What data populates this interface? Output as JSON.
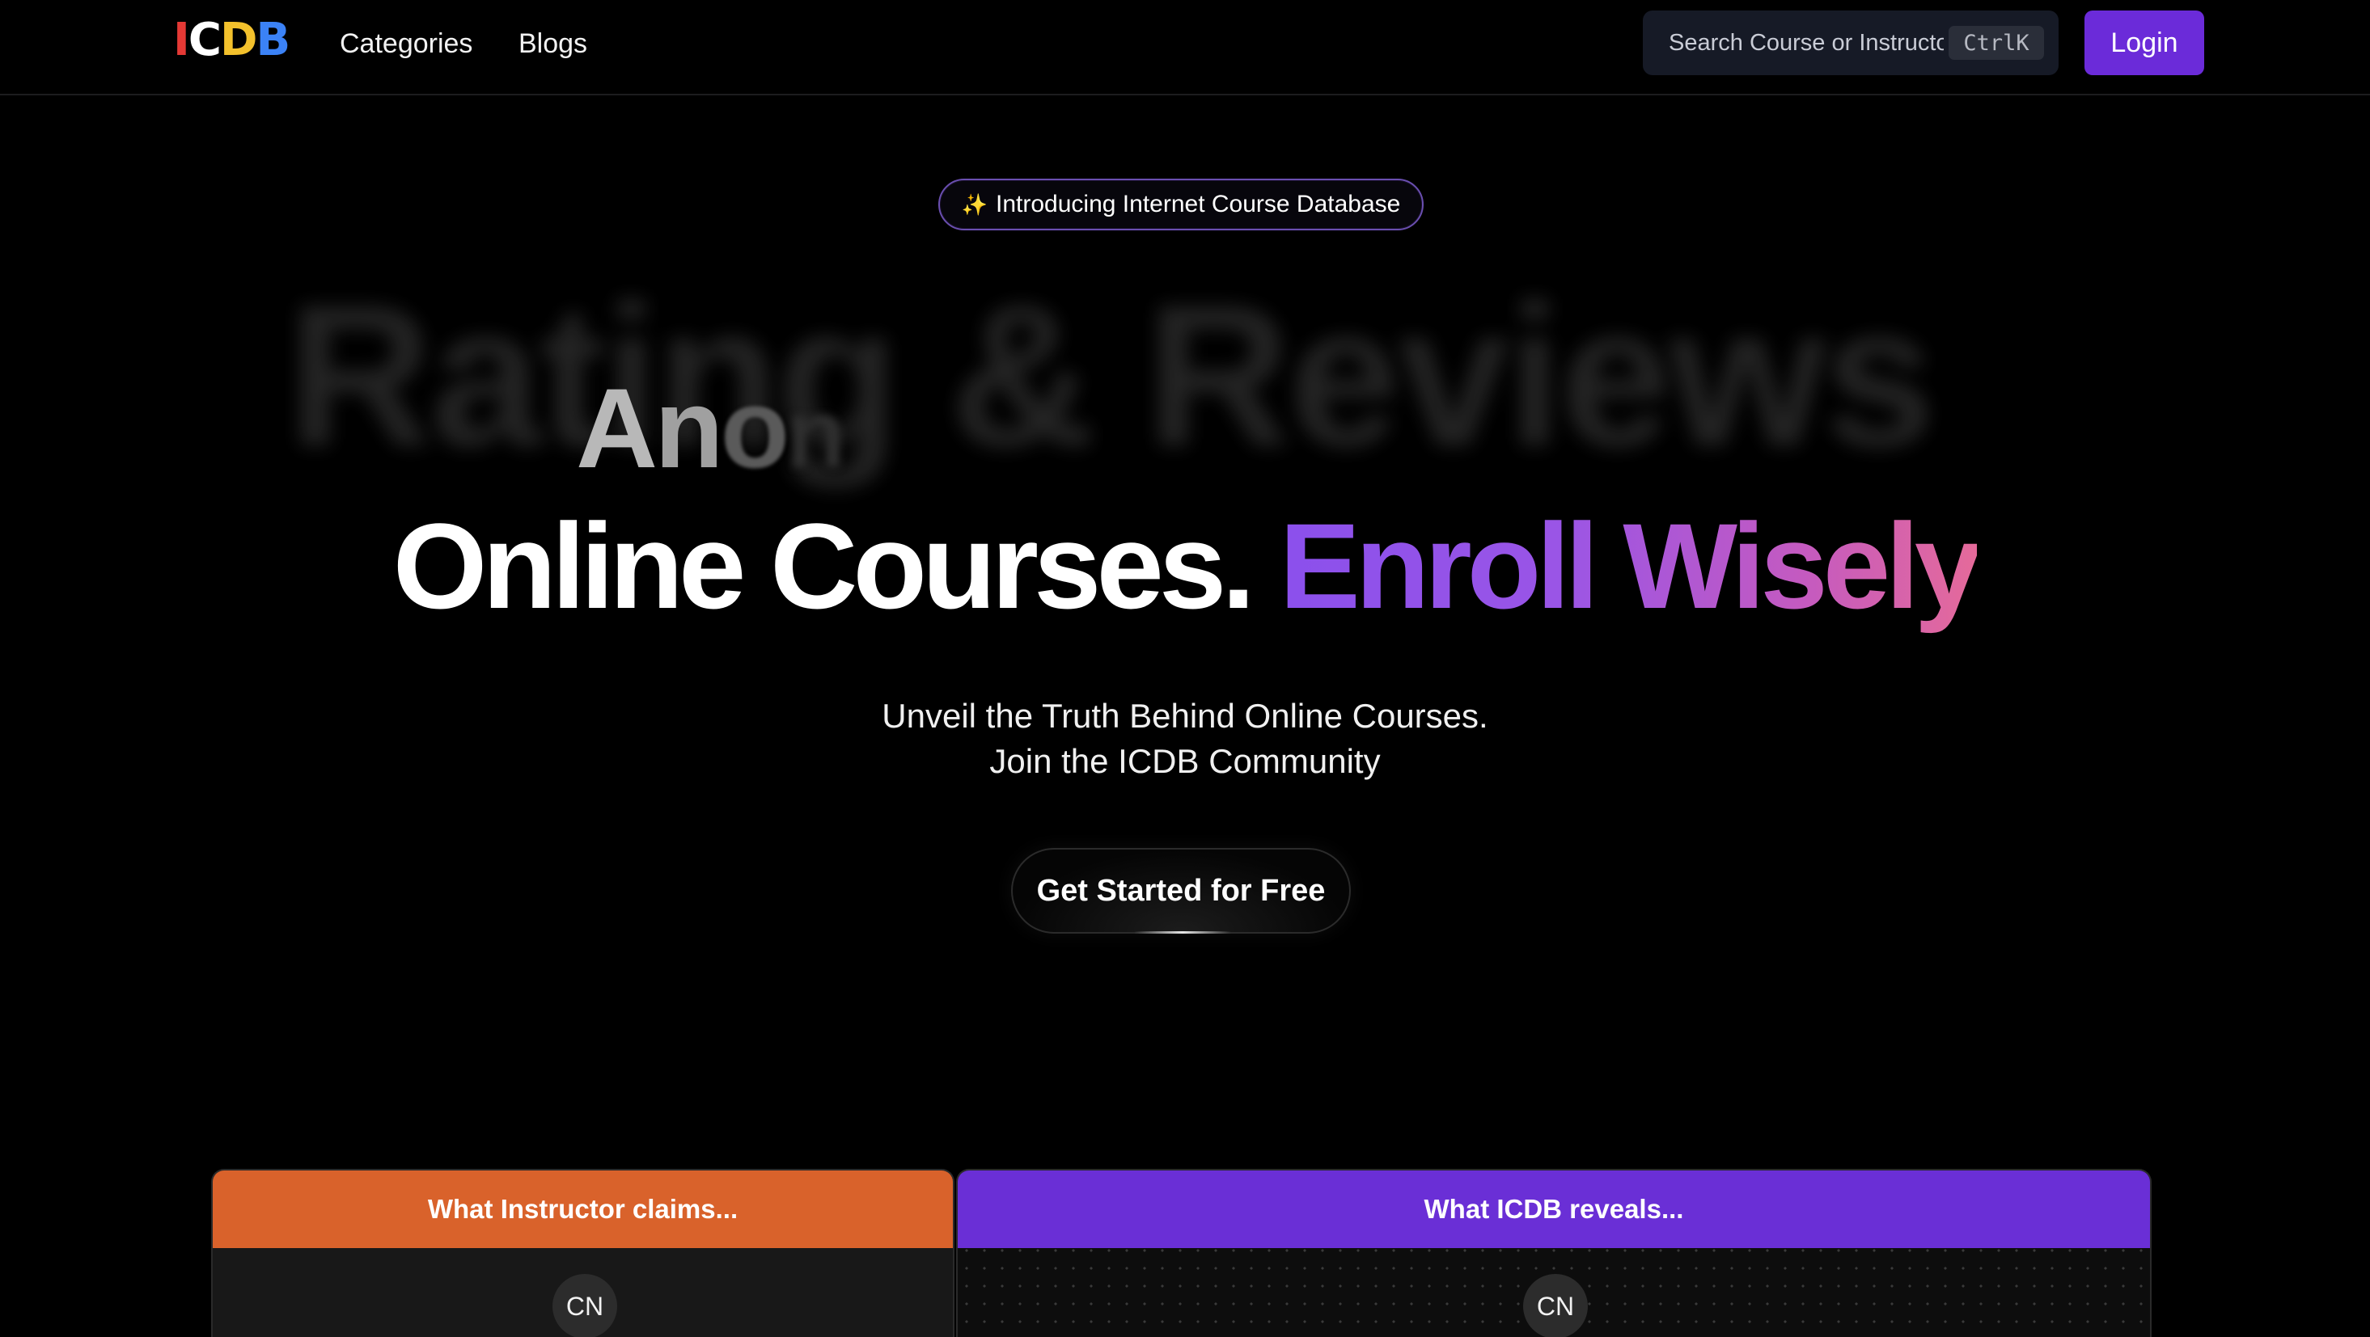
{
  "nav": {
    "logo": {
      "letters": [
        "I",
        "C",
        "D",
        "B"
      ],
      "colors": [
        "#e53935",
        "#ffffff",
        "#f3c12c",
        "#3b82f6"
      ]
    },
    "links": [
      "Categories",
      "Blogs"
    ],
    "search": {
      "placeholder": "Search Course or Instructor",
      "shortcut": "CtrlK"
    },
    "login_label": "Login"
  },
  "hero": {
    "badge": {
      "icon": "sparkle-icon",
      "text": "Introducing Internet Course Database"
    },
    "rotating_background": "Rating & Reviews",
    "rotating_word_partial": [
      "A",
      "n",
      "o",
      "n"
    ],
    "headline_white": "Online Courses.",
    "headline_gradient": "Enroll Wisely",
    "subtitle_line1": "Unveil the Truth Behind Online Courses.",
    "subtitle_line2": "Join the ICDB Community",
    "cta_label": "Get Started for Free"
  },
  "comparison": {
    "left_title": "What Instructor claims...",
    "right_title": "What ICDB reveals...",
    "left_avatar": "CN",
    "right_avatar": "CN"
  },
  "colors": {
    "accent_purple": "#6b2bd9",
    "claims_orange": "#d9622b",
    "reveals_purple": "#6a2fd6",
    "gradient_start": "#8b50ec",
    "gradient_end": "#e56a9a"
  }
}
